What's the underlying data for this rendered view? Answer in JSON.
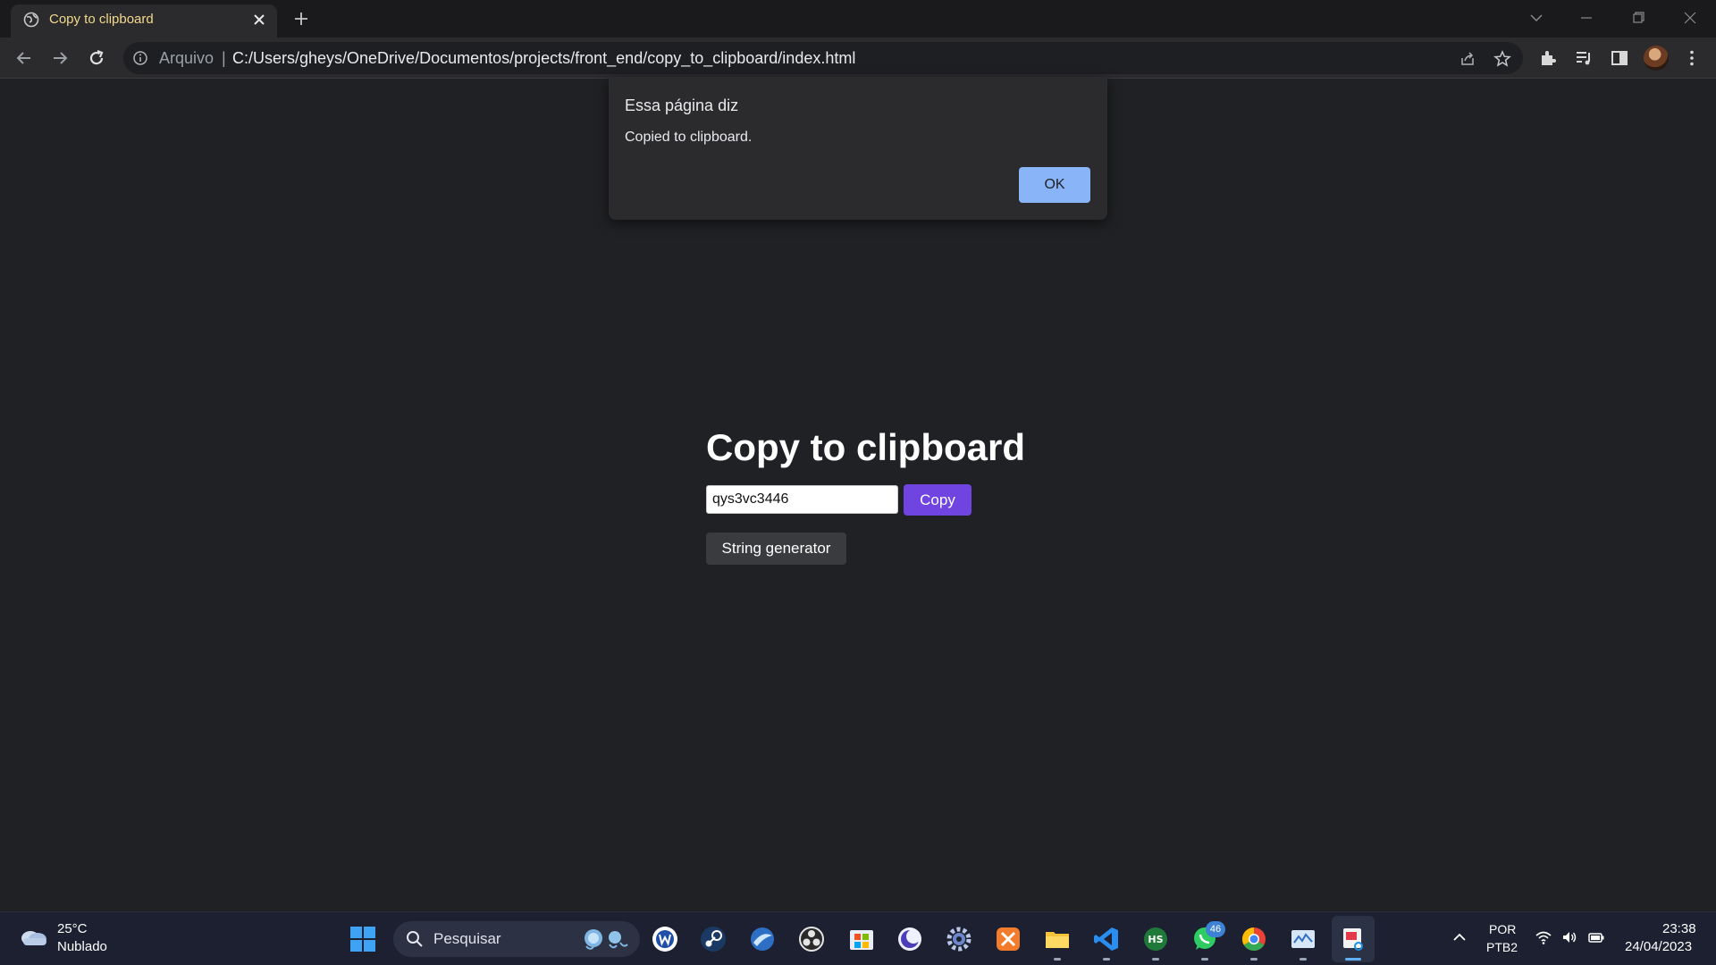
{
  "browser": {
    "tab_title": "Copy to clipboard",
    "url_scheme_label": "Arquivo",
    "url_separator": "|",
    "url": "C:/Users/gheys/OneDrive/Documentos/projects/front_end/copy_to_clipboard/index.html"
  },
  "page": {
    "heading": "Copy to clipboard",
    "input_value": "qys3vc3446",
    "copy_label": "Copy",
    "generator_label": "String generator"
  },
  "dialog": {
    "title": "Essa página diz",
    "message": "Copied to clipboard.",
    "ok_label": "OK"
  },
  "taskbar": {
    "weather_temp": "25°C",
    "weather_desc": "Nublado",
    "search_placeholder": "Pesquisar",
    "whatsapp_badge": "46",
    "lang_primary": "POR",
    "lang_secondary": "PTB2",
    "time": "23:38",
    "date": "24/04/2023"
  },
  "colors": {
    "copy_button": "#7044e0",
    "ok_button": "#8ab4f8",
    "tab_title": "#f2d98b",
    "page_background": "#202124"
  },
  "icons": [
    "globe-icon",
    "close-icon",
    "plus-icon",
    "back-icon",
    "forward-icon",
    "reload-icon",
    "info-icon",
    "share-icon",
    "star-icon",
    "extensions-icon",
    "media-icon",
    "sidepanel-icon",
    "menu-icon",
    "weather-cloud-icon",
    "windows-start-icon",
    "search-icon"
  ]
}
